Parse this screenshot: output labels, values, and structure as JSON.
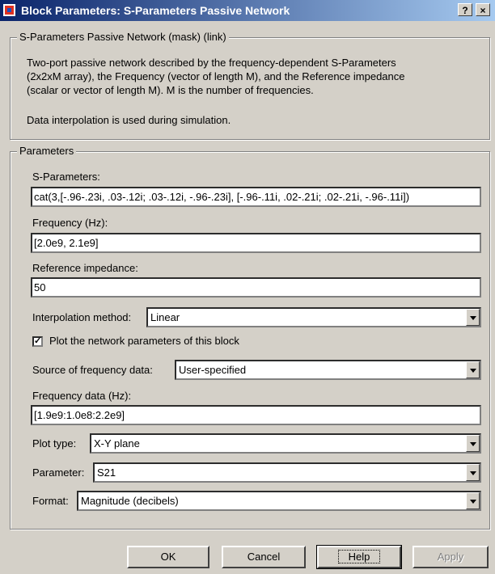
{
  "window": {
    "title": "Block Parameters: S-Parameters Passive Network",
    "help_button": "?",
    "close_button": "×"
  },
  "mask": {
    "legend": "S-Parameters Passive Network (mask) (link)",
    "description_lines": [
      "Two-port passive network described by the frequency-dependent S-Parameters",
      "(2x2xM array),  the Frequency (vector of length M), and the Reference impedance",
      "(scalar or vector of length M).  M is the number of frequencies."
    ],
    "note": "Data interpolation is used during simulation."
  },
  "parameters": {
    "legend": "Parameters",
    "s_parameters": {
      "label": "S-Parameters:",
      "value": "cat(3,[-.96-.23i, .03-.12i; .03-.12i, -.96-.23i], [-.96-.11i, .02-.21i; .02-.21i, -.96-.11i])"
    },
    "frequency": {
      "label": "Frequency (Hz):",
      "value": "[2.0e9, 2.1e9]"
    },
    "reference_impedance": {
      "label": "Reference impedance:",
      "value": "50"
    },
    "interpolation": {
      "label": "Interpolation method:",
      "value": "Linear"
    },
    "plot_checkbox": {
      "label": "Plot the network parameters of this block",
      "checked": true,
      "mark": "✓"
    },
    "source_freq": {
      "label": "Source of frequency data:",
      "value": "User-specified"
    },
    "frequency_data": {
      "label": "Frequency data (Hz):",
      "value": "[1.9e9:1.0e8:2.2e9]"
    },
    "plot_type": {
      "label": "Plot type:",
      "value": "X-Y plane"
    },
    "parameter": {
      "label": "Parameter:",
      "value": "S21"
    },
    "format": {
      "label": "Format:",
      "value": "Magnitude (decibels)"
    }
  },
  "buttons": {
    "ok": "OK",
    "cancel": "Cancel",
    "help": "Help",
    "apply": "Apply"
  }
}
